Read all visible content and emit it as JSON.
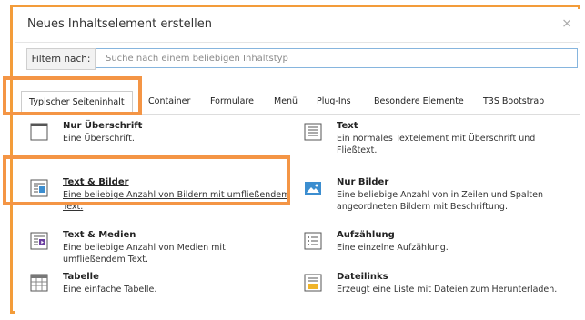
{
  "dialog": {
    "title": "Neues Inhaltselement erstellen",
    "close_symbol": "×"
  },
  "filter": {
    "label": "Filtern nach:",
    "placeholder": "Suche nach einem beliebigen Inhaltstyp"
  },
  "tabs": [
    {
      "label": "Typischer Seiteninhalt",
      "active": true
    },
    {
      "label": "Container"
    },
    {
      "label": "Formulare"
    },
    {
      "label": "Menü"
    },
    {
      "label": "Plug-Ins"
    },
    {
      "label": "Besondere Elemente"
    },
    {
      "label": "T3S Bootstrap"
    }
  ],
  "items": [
    {
      "name": "Nur Überschrift",
      "desc": "Eine Überschrift.",
      "icon": "header-icon"
    },
    {
      "name": "Text",
      "desc": "Ein normales Textelement mit Überschrift und Fließtext.",
      "icon": "text-icon"
    },
    {
      "name": "Text & Bilder",
      "desc": "Eine beliebige Anzahl von Bildern mit umfließendem Text.",
      "icon": "text-image-icon"
    },
    {
      "name": "Nur Bilder",
      "desc": "Eine beliebige Anzahl von in Zeilen und Spalten angeordneten Bildern mit Beschriftung.",
      "icon": "images-icon"
    },
    {
      "name": "Text & Medien",
      "desc": "Eine beliebige Anzahl von Medien mit umfließendem Text.",
      "icon": "text-media-icon"
    },
    {
      "name": "Aufzählung",
      "desc": "Eine einzelne Aufzählung.",
      "icon": "bullets-icon"
    },
    {
      "name": "Tabelle",
      "desc": "Eine einfache Tabelle.",
      "icon": "table-icon"
    },
    {
      "name": "Dateilinks",
      "desc": "Erzeugt eine Liste mit Dateien zum Herunterladen.",
      "icon": "filelinks-icon"
    }
  ],
  "colors": {
    "highlight": "#f49545",
    "input_border": "#86b5de",
    "icon_blue": "#3c8ed0",
    "icon_purple": "#6b3fa0",
    "icon_yellow": "#f0b429"
  }
}
